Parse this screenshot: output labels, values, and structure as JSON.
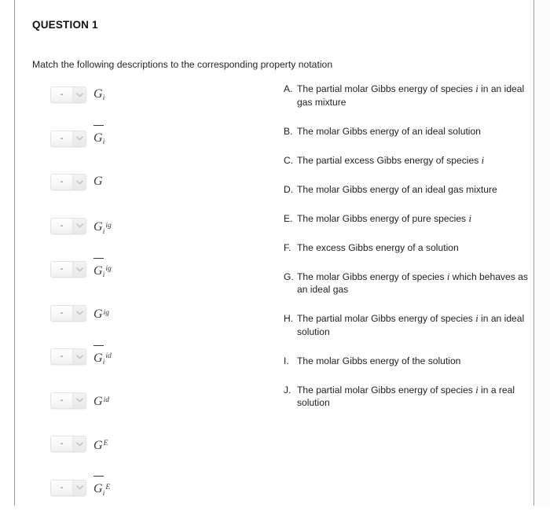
{
  "question": {
    "title": "QUESTION 1",
    "instruction": "Match the following descriptions to the corresponding property notation"
  },
  "dropdown": {
    "selected_value": "-",
    "arrow_icon": "chevron-down-icon"
  },
  "match_items": [
    {
      "id": 1,
      "notation_text": "G i",
      "base": "G",
      "bar": false,
      "sub": "i",
      "sup": ""
    },
    {
      "id": 2,
      "notation_text": "G bar i",
      "base": "G",
      "bar": true,
      "sub": "i",
      "sup": ""
    },
    {
      "id": 3,
      "notation_text": "G",
      "base": "G",
      "bar": false,
      "sub": "",
      "sup": ""
    },
    {
      "id": 4,
      "notation_text": "G i ig",
      "base": "G",
      "bar": false,
      "sub": "i",
      "sup": "ig"
    },
    {
      "id": 5,
      "notation_text": "G bar i ig",
      "base": "G",
      "bar": true,
      "sub": "i",
      "sup": "ig"
    },
    {
      "id": 6,
      "notation_text": "G ig",
      "base": "G",
      "bar": false,
      "sub": "",
      "sup": "ig"
    },
    {
      "id": 7,
      "notation_text": "G bar i id",
      "base": "G",
      "bar": true,
      "sub": "i",
      "sup": "id"
    },
    {
      "id": 8,
      "notation_text": "G id",
      "base": "G",
      "bar": false,
      "sub": "",
      "sup": "id"
    },
    {
      "id": 9,
      "notation_text": "G E",
      "base": "G",
      "bar": false,
      "sub": "",
      "sup": "E"
    },
    {
      "id": 10,
      "notation_text": "G bar i E",
      "base": "G",
      "bar": true,
      "sub": "i",
      "sup": "E"
    }
  ],
  "options": [
    {
      "letter": "A.",
      "parts": [
        "The partial molar Gibbs energy of species ",
        "i",
        " in an ideal gas mixture"
      ]
    },
    {
      "letter": "B.",
      "parts": [
        "The molar Gibbs energy of an ideal solution",
        "",
        ""
      ]
    },
    {
      "letter": "C.",
      "parts": [
        "The partial excess Gibbs energy of species ",
        "i",
        ""
      ]
    },
    {
      "letter": "D.",
      "parts": [
        "The molar Gibbs energy of an ideal gas mixture",
        "",
        ""
      ]
    },
    {
      "letter": "E.",
      "parts": [
        "The molar Gibbs energy of pure species ",
        "i",
        ""
      ]
    },
    {
      "letter": "F.",
      "parts": [
        "The excess Gibbs energy of a solution",
        "",
        ""
      ]
    },
    {
      "letter": "G.",
      "parts": [
        "The molar Gibbs energy of species ",
        "i",
        " which behaves as an ideal gas"
      ]
    },
    {
      "letter": "H.",
      "parts": [
        "The partial molar Gibbs energy of species ",
        "i",
        " in an ideal solution"
      ]
    },
    {
      "letter": "I.",
      "parts": [
        "The molar Gibbs energy of the solution",
        "",
        ""
      ]
    },
    {
      "letter": "J.",
      "parts": [
        "The partial molar Gibbs energy of species ",
        "i",
        " in a real solution"
      ]
    }
  ],
  "colors": {
    "page_background": "#ffffff",
    "border": "#9a9a9a",
    "text": "#1f1f1f",
    "notation": "#3a3a3a",
    "dropdown_border": "#e3e3e3"
  }
}
